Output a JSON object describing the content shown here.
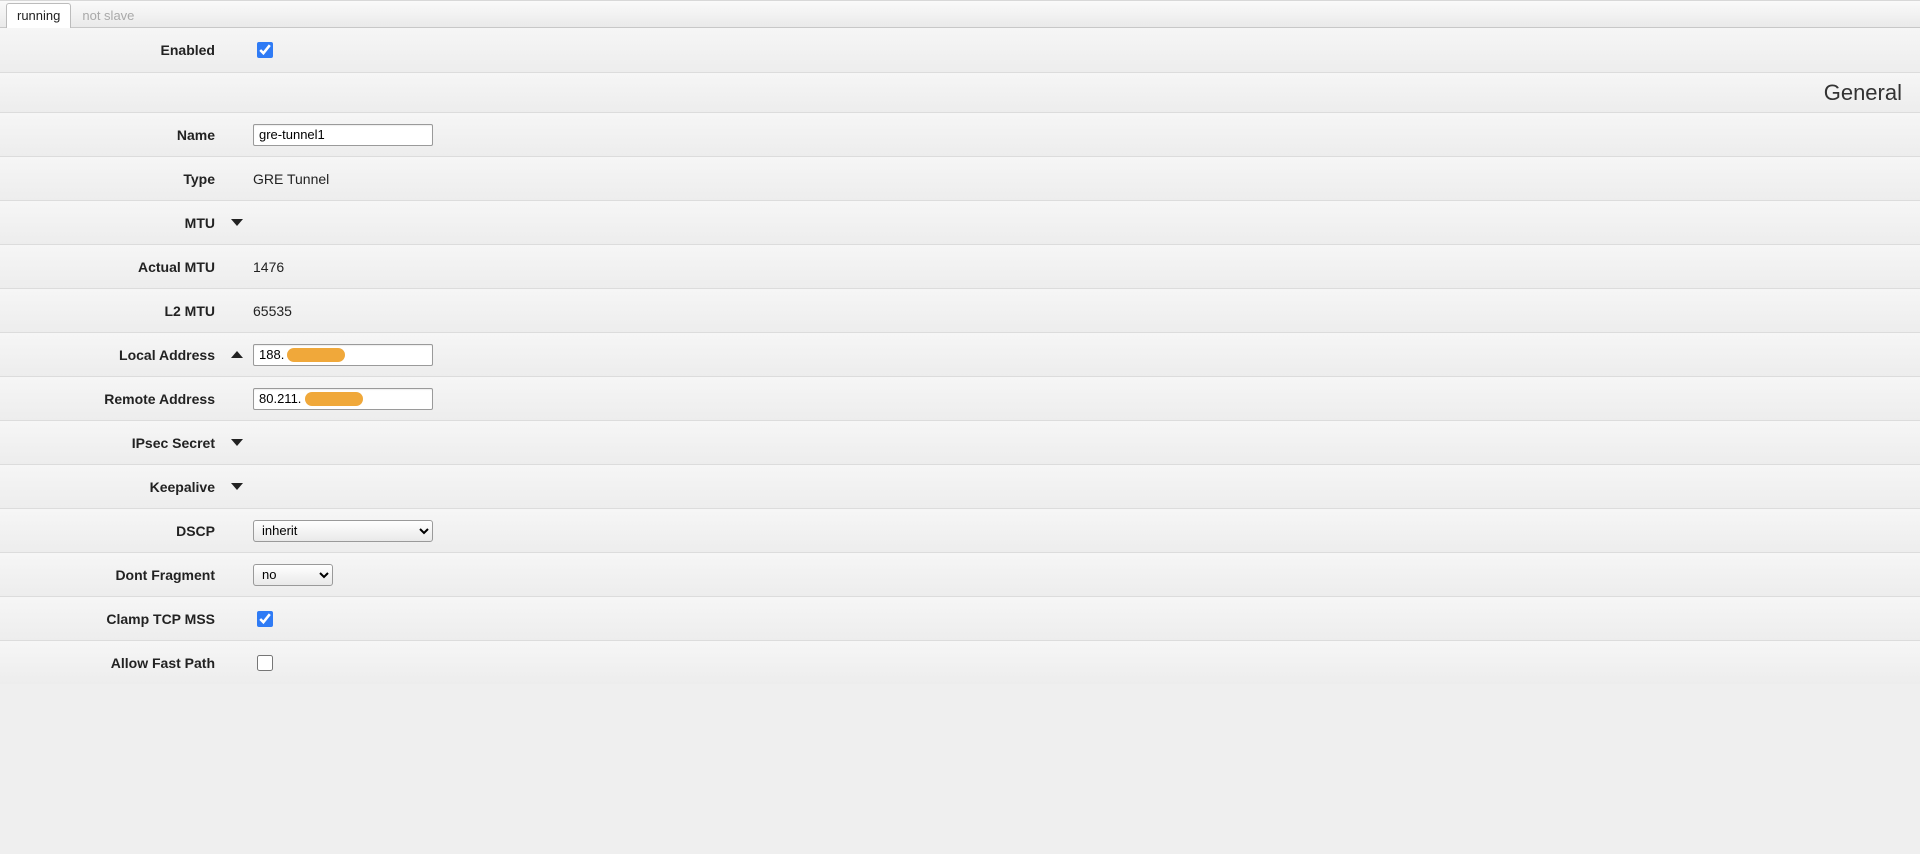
{
  "tabs": {
    "running": "running",
    "not_slave": "not slave"
  },
  "section_general": "General",
  "labels": {
    "enabled": "Enabled",
    "name": "Name",
    "type": "Type",
    "mtu": "MTU",
    "actual_mtu": "Actual MTU",
    "l2_mtu": "L2 MTU",
    "local_address": "Local Address",
    "remote_address": "Remote Address",
    "ipsec_secret": "IPsec Secret",
    "keepalive": "Keepalive",
    "dscp": "DSCP",
    "dont_fragment": "Dont Fragment",
    "clamp_tcp_mss": "Clamp TCP MSS",
    "allow_fast_path": "Allow Fast Path"
  },
  "values": {
    "name": "gre-tunnel1",
    "type": "GRE Tunnel",
    "actual_mtu": "1476",
    "l2_mtu": "65535",
    "local_address": "188.",
    "remote_address": "80.211.",
    "dscp": "inherit",
    "dont_fragment": "no"
  },
  "checks": {
    "enabled": true,
    "clamp_tcp_mss": true,
    "allow_fast_path": false
  }
}
